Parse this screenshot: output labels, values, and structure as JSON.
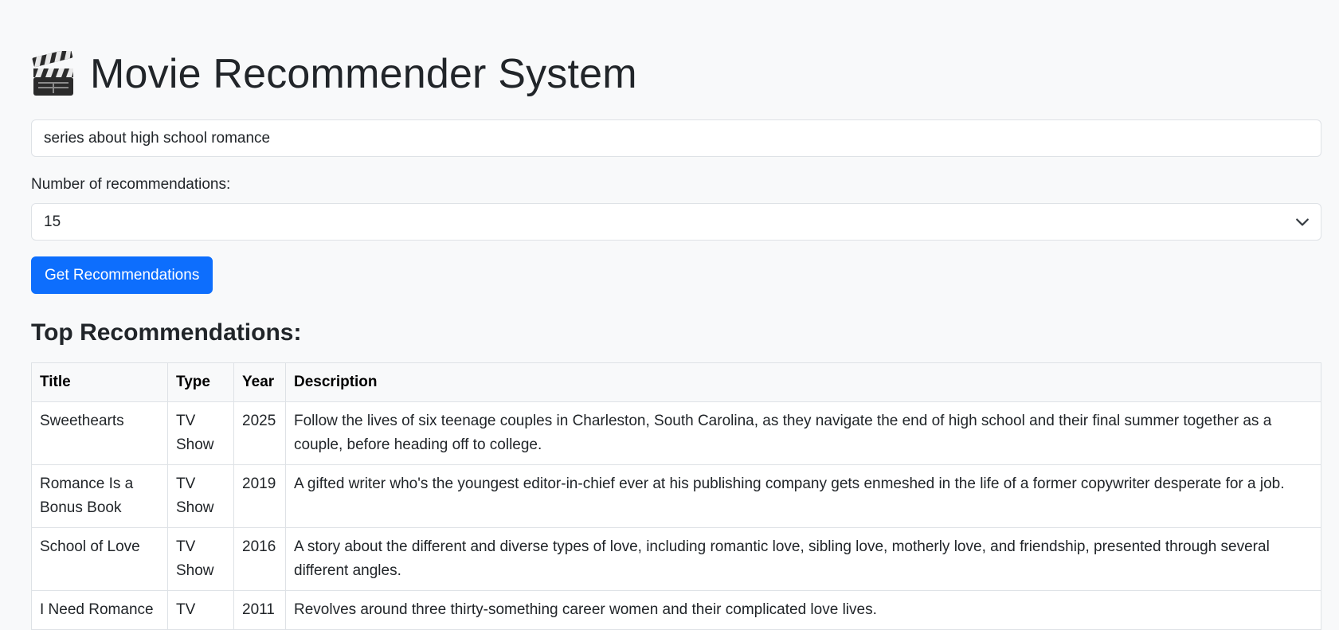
{
  "header": {
    "title": "Movie Recommender System",
    "icon": "clapperboard-icon"
  },
  "search": {
    "value": "series about high school romance"
  },
  "count_select": {
    "label": "Number of recommendations:",
    "selected": "15"
  },
  "submit": {
    "label": "Get Recommendations"
  },
  "results": {
    "heading": "Top Recommendations:",
    "columns": [
      "Title",
      "Type",
      "Year",
      "Description"
    ],
    "rows": [
      {
        "title": "Sweethearts",
        "type": "TV Show",
        "year": "2025",
        "description": "Follow the lives of six teenage couples in Charleston, South Carolina, as they navigate the end of high school and their final summer together as a couple, before heading off to college."
      },
      {
        "title": "Romance Is a Bonus Book",
        "type": "TV Show",
        "year": "2019",
        "description": "A gifted writer who's the youngest editor-in-chief ever at his publishing company gets enmeshed in the life of a former copywriter desperate for a job."
      },
      {
        "title": "School of Love",
        "type": "TV Show",
        "year": "2016",
        "description": "A story about the different and diverse types of love, including romantic love, sibling love, motherly love, and friendship, presented through several different angles."
      },
      {
        "title": "I Need Romance",
        "type": "TV",
        "year": "2011",
        "description": "Revolves around three thirty-something career women and their complicated love lives."
      }
    ]
  },
  "colors": {
    "background": "#f8f9fa",
    "primary": "#0d6efd",
    "border": "#dee2e6",
    "text": "#212529"
  }
}
